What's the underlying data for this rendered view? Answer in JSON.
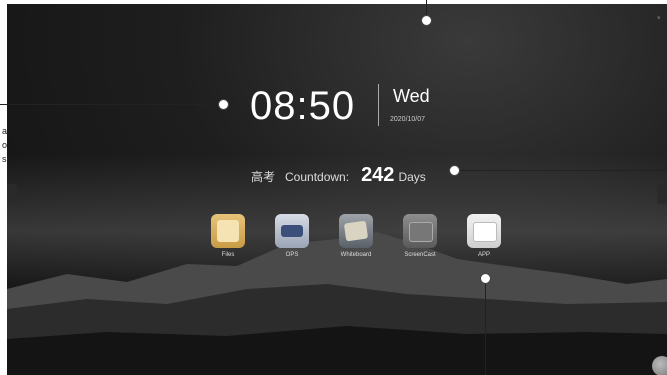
{
  "clock": {
    "time": "08:50",
    "weekday": "Wed",
    "date": "2020/10/07"
  },
  "countdown": {
    "cn_label": "高考",
    "label": "Countdown:",
    "value": "242",
    "unit": "Days"
  },
  "apps": [
    {
      "label": "Files",
      "icon": "folder-icon"
    },
    {
      "label": "OPS",
      "icon": "ops-pc-icon"
    },
    {
      "label": "Whiteboard",
      "icon": "whiteboard-icon"
    },
    {
      "label": "ScreenCast",
      "icon": "screencast-icon"
    },
    {
      "label": "APP",
      "icon": "app-store-icon"
    }
  ],
  "left_annotation": [
    "a",
    "o",
    "s."
  ]
}
